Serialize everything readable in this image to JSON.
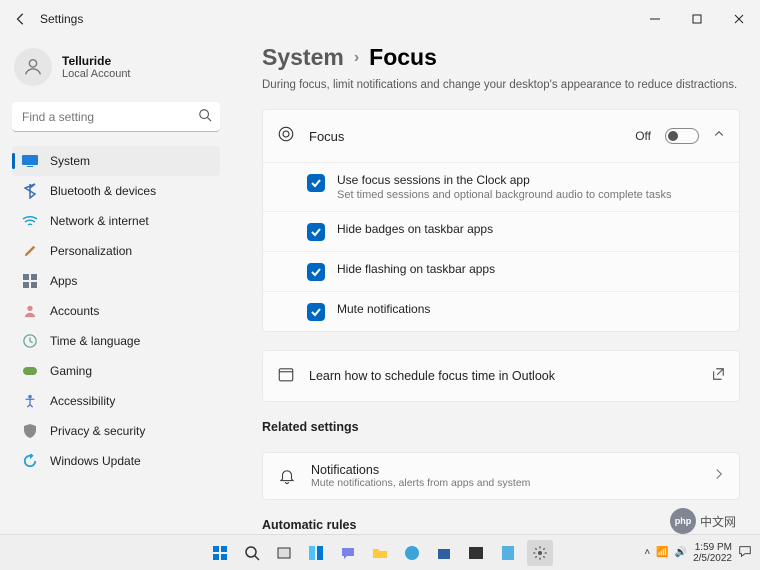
{
  "window": {
    "title": "Settings"
  },
  "user": {
    "name": "Telluride",
    "sub": "Local Account"
  },
  "search": {
    "placeholder": "Find a setting"
  },
  "nav": [
    {
      "label": "System",
      "icon": "system",
      "color": "#1e7fd6",
      "active": true
    },
    {
      "label": "Bluetooth & devices",
      "icon": "bluetooth",
      "color": "#3a6fb0"
    },
    {
      "label": "Network & internet",
      "icon": "wifi",
      "color": "#25a2c9"
    },
    {
      "label": "Personalization",
      "icon": "brush",
      "color": "#c77c3a"
    },
    {
      "label": "Apps",
      "icon": "apps",
      "color": "#6e7a87"
    },
    {
      "label": "Accounts",
      "icon": "account",
      "color": "#d88b8b"
    },
    {
      "label": "Time & language",
      "icon": "time",
      "color": "#6aa49b"
    },
    {
      "label": "Gaming",
      "icon": "game",
      "color": "#6fa24e"
    },
    {
      "label": "Accessibility",
      "icon": "access",
      "color": "#4a7bc9"
    },
    {
      "label": "Privacy & security",
      "icon": "shield",
      "color": "#8a8a8a"
    },
    {
      "label": "Windows Update",
      "icon": "update",
      "color": "#2a9dd6"
    }
  ],
  "breadcrumb": {
    "parent": "System",
    "current": "Focus"
  },
  "description": "During focus, limit notifications and change your desktop's appearance to reduce distractions.",
  "focusPanel": {
    "title": "Focus",
    "state": "Off",
    "options": [
      {
        "label": "Use focus sessions in the Clock app",
        "sub": "Set timed sessions and optional background audio to complete tasks",
        "checked": true
      },
      {
        "label": "Hide badges on taskbar apps",
        "checked": true
      },
      {
        "label": "Hide flashing on taskbar apps",
        "checked": true
      },
      {
        "label": "Mute notifications",
        "checked": true
      }
    ]
  },
  "outlook": {
    "label": "Learn how to schedule focus time in Outlook"
  },
  "related": {
    "title": "Related settings",
    "items": [
      {
        "title": "Notifications",
        "sub": "Mute notifications, alerts from apps and system"
      }
    ]
  },
  "auto": {
    "title": "Automatic rules"
  },
  "tray": {
    "time": "1:59 PM",
    "date": "2/5/2022"
  },
  "watermark": {
    "logo": "php",
    "text": "中文网"
  }
}
